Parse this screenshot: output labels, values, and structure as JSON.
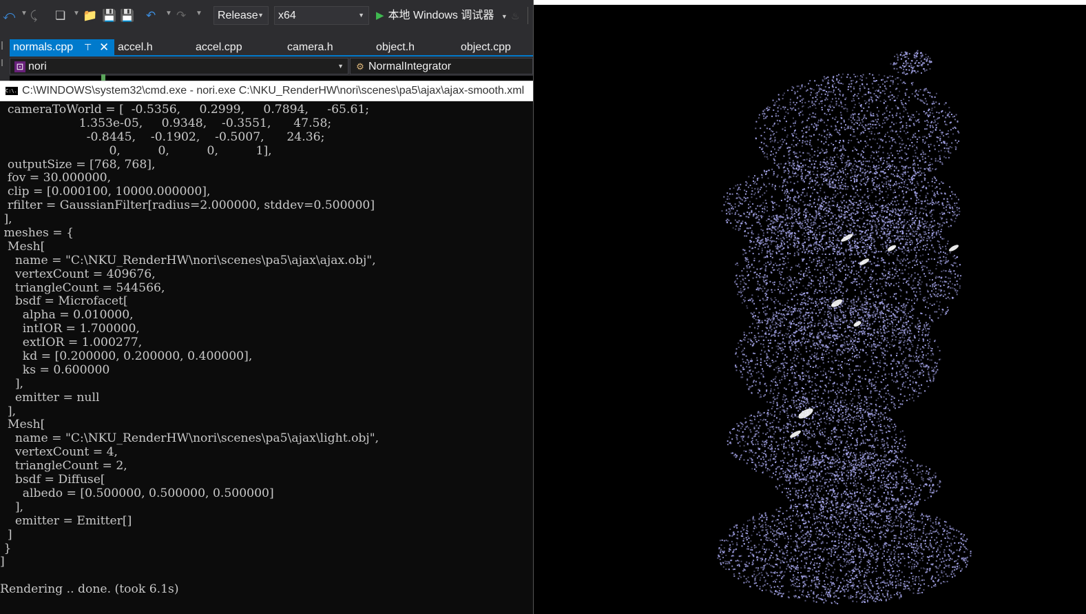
{
  "toolbar": {
    "icons": [
      "back-arrow-icon",
      "forward-arrow-icon",
      "new-project-icon",
      "open-folder-icon",
      "save-icon",
      "save-all-icon",
      "undo-icon",
      "redo-icon"
    ],
    "configuration": "Release",
    "platform": "x64",
    "run_label": "本地 Windows 调试器"
  },
  "tabs": [
    {
      "label": "normals.cpp",
      "active": true
    },
    {
      "label": "accel.h",
      "active": false
    },
    {
      "label": "accel.cpp",
      "active": false
    },
    {
      "label": "camera.h",
      "active": false
    },
    {
      "label": "object.h",
      "active": false
    },
    {
      "label": "object.cpp",
      "active": false
    }
  ],
  "nav": {
    "project": "nori",
    "scope": "NormalIntegrator"
  },
  "console": {
    "title": "C:\\WINDOWS\\system32\\cmd.exe - nori.exe  C:\\NKU_RenderHW\\nori\\scenes\\pa5\\ajax\\ajax-smooth.xml",
    "icon_text": "C:\\.",
    "lines": [
      "  cameraToWorld = [  -0.5356,     0.2999,     0.7894,     -65.61;",
      "                     1.353e-05,     0.9348,    -0.3551,      47.58;",
      "                       -0.8445,    -0.1902,    -0.5007,      24.36;",
      "                             0,          0,          0,          1],",
      "  outputSize = [768, 768],",
      "  fov = 30.000000,",
      "  clip = [0.000100, 10000.000000],",
      "  rfilter = GaussianFilter[radius=2.000000, stddev=0.500000]",
      " ],",
      " meshes = {",
      "  Mesh[",
      "    name = \"C:\\NKU_RenderHW\\nori\\scenes\\pa5\\ajax\\ajax.obj\",",
      "    vertexCount = 409676,",
      "    triangleCount = 544566,",
      "    bsdf = Microfacet[",
      "      alpha = 0.010000,",
      "      intIOR = 1.700000,",
      "      extIOR = 1.000277,",
      "      kd = [0.200000, 0.200000, 0.400000],",
      "      ks = 0.600000",
      "    ],",
      "    emitter = null",
      "  ],",
      "  Mesh[",
      "    name = \"C:\\NKU_RenderHW\\nori\\scenes\\pa5\\ajax\\light.obj\",",
      "    vertexCount = 4,",
      "    triangleCount = 2,",
      "    bsdf = Diffuse[",
      "      albedo = [0.500000, 0.500000, 0.500000]",
      "    ],",
      "    emitter = Emitter[]",
      "  ]",
      " }",
      "]",
      "",
      "Rendering .. done. (took 6.1s)"
    ]
  },
  "render": {
    "point_color": "#a8a8ee",
    "highlight_color": "#ffffff",
    "background": "#000000"
  }
}
